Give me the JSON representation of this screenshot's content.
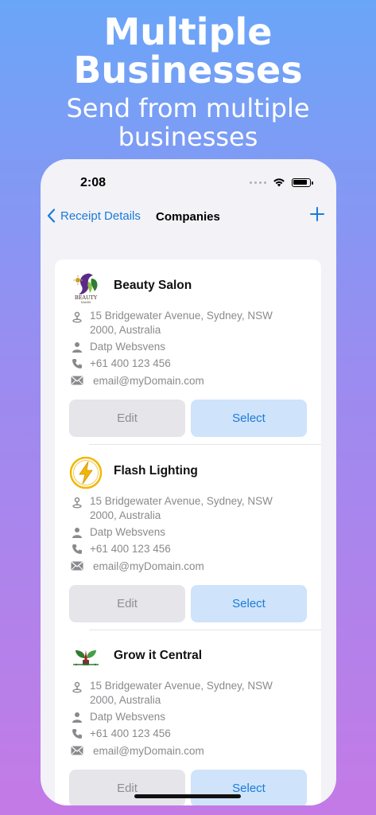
{
  "hero": {
    "title_line1": "Multiple",
    "title_line2": "Businesses",
    "subtitle": "Send from multiple businesses"
  },
  "status_bar": {
    "time": "2:08"
  },
  "nav": {
    "back_label": "Receipt Details",
    "title": "Companies"
  },
  "companies": [
    {
      "name": "Beauty Salon",
      "logo": "beauty-salon-logo",
      "logo_text": "BEAUTY",
      "logo_subtext": "SALON",
      "address": "15 Bridgewater Avenue, Sydney, NSW 2000, Australia",
      "contact": "Datp Websvens",
      "phone": "+61 400 123 456",
      "email": "email@myDomain.com",
      "edit_label": "Edit",
      "select_label": "Select"
    },
    {
      "name": "Flash Lighting",
      "logo": "lightning-logo",
      "address": "15 Bridgewater Avenue, Sydney, NSW 2000, Australia",
      "contact": "Datp Websvens",
      "phone": "+61 400 123 456",
      "email": "email@myDomain.com",
      "edit_label": "Edit",
      "select_label": "Select"
    },
    {
      "name": "Grow it Central",
      "logo": "plant-logo",
      "address": "15 Bridgewater Avenue, Sydney, NSW 2000, Australia",
      "contact": "Datp Websvens",
      "phone": "+61 400 123 456",
      "email": "email@myDomain.com",
      "edit_label": "Edit",
      "select_label": "Select"
    }
  ],
  "colors": {
    "accent": "#1a7bd9",
    "select_bg": "#cfe3fa",
    "edit_bg": "#e5e5ea",
    "secondary_text": "#8a8a8e"
  }
}
